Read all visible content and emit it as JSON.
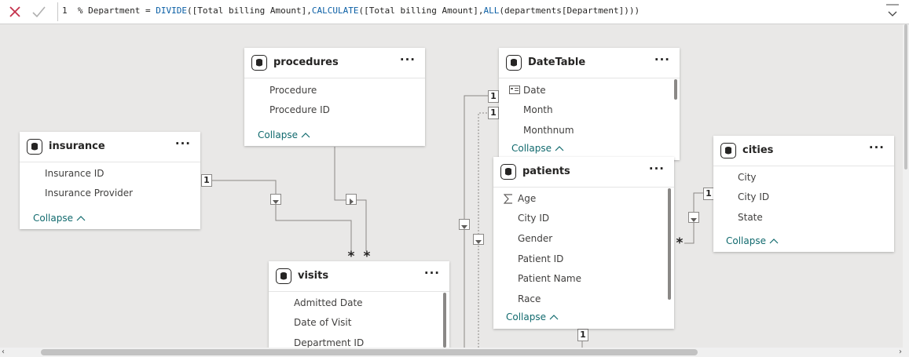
{
  "formula_bar": {
    "line_number": "1",
    "formula_plain": "% Department = ",
    "formula_func": "DIVIDE",
    "formula_arg1": "([Total billing Amount],",
    "formula_func2": "CALCULATE",
    "formula_arg2": "([Total billing Amount],",
    "formula_func3": "ALL",
    "formula_arg3": "(departments[Department])))",
    "cancel_icon": "x-icon",
    "commit_icon": "check-icon",
    "expand_icon": "chevron-down-icon"
  },
  "tables": {
    "procedures": {
      "title": "procedures",
      "more": "···",
      "fields": [
        "Procedure",
        "Procedure ID"
      ],
      "collapse": "Collapse"
    },
    "datetable": {
      "title": "DateTable",
      "more": "···",
      "fields": [
        "Date",
        "Month",
        "Monthnum"
      ],
      "collapse": "Collapse"
    },
    "insurance": {
      "title": "insurance",
      "more": "···",
      "fields": [
        "Insurance ID",
        "Insurance Provider"
      ],
      "collapse": "Collapse"
    },
    "patients": {
      "title": "patients",
      "more": "···",
      "fields": [
        "Age",
        "City ID",
        "Gender",
        "Patient ID",
        "Patient Name",
        "Race"
      ],
      "collapse": "Collapse"
    },
    "cities": {
      "title": "cities",
      "more": "···",
      "fields": [
        "City",
        "City ID",
        "State"
      ],
      "collapse": "Collapse"
    },
    "visits": {
      "title": "visits",
      "more": "···",
      "fields": [
        "Admitted Date",
        "Date of Visit",
        "Department ID"
      ]
    }
  },
  "cardinality": {
    "one": "1",
    "many": "*"
  },
  "colors": {
    "link": "#116a6e",
    "cancel": "#c4314b",
    "line": "#8a8886"
  }
}
